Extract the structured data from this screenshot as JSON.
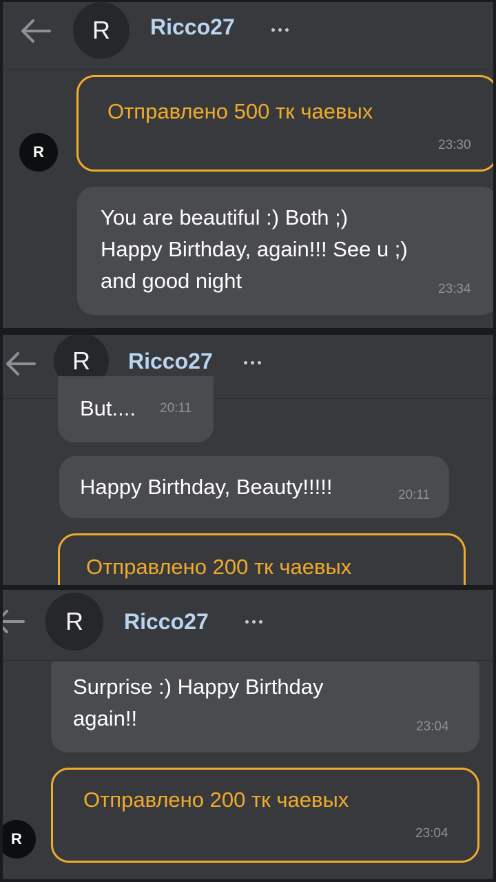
{
  "screenshots": [
    {
      "header": {
        "back_icon": "arrow-left-icon",
        "avatar_initial": "R",
        "username": "Ricco27",
        "more_icon": "more-dots-icon"
      },
      "tip": {
        "text": "Отправлено 500 тк чаевых",
        "time": "23:30",
        "avatar_initial": "R"
      },
      "message": {
        "text": "You are beautiful :) Both ;)\nHappy Birthday, again!!! See u ;)\nand good night",
        "time": "23:34"
      }
    },
    {
      "header": {
        "back_icon": "arrow-left-icon",
        "avatar_initial": "R",
        "username": "Ricco27",
        "more_icon": "more-dots-icon"
      },
      "message_partial": {
        "text": "But....",
        "time": "20:11"
      },
      "message": {
        "text": "Happy Birthday, Beauty!!!!!",
        "time": "20:11"
      },
      "tip_partial": {
        "text": "Отправлено 200 тк чаевых"
      }
    },
    {
      "header": {
        "back_icon": "arrow-left-icon",
        "avatar_initial": "R",
        "username": "Ricco27",
        "more_icon": "more-dots-icon"
      },
      "message": {
        "text": "Surprise :) Happy Birthday\nagain!!",
        "time": "23:04"
      },
      "tip": {
        "text": "Отправлено 200 тк чаевых",
        "time": "23:04",
        "avatar_initial": "R"
      }
    }
  ],
  "colors": {
    "background": "#38393d",
    "bubble": "#4a4b4f",
    "tip_accent": "#f0ab2a",
    "username": "#b9d5f1",
    "timestamp": "#909196"
  }
}
